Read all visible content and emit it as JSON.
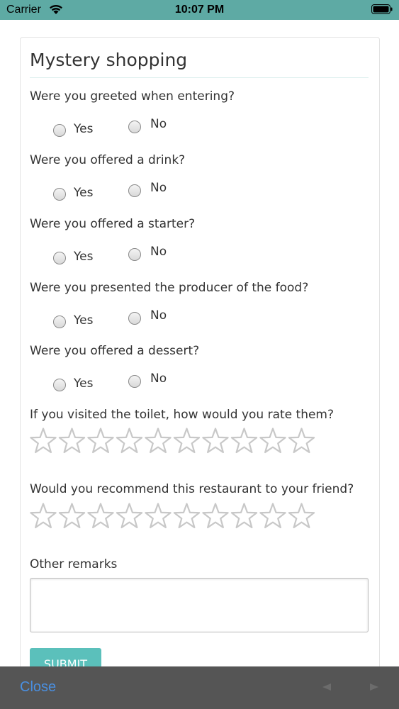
{
  "status_bar": {
    "carrier": "Carrier",
    "time": "10:07 PM"
  },
  "form": {
    "title": "Mystery shopping",
    "questions": [
      {
        "text": "Were you greeted when entering?",
        "yes_label": "Yes",
        "no_label": "No"
      },
      {
        "text": "Were you offered a drink?",
        "yes_label": "Yes",
        "no_label": "No"
      },
      {
        "text": "Were you offered a starter?",
        "yes_label": "Yes",
        "no_label": "No"
      },
      {
        "text": "Were you presented the producer of the food?",
        "yes_label": "Yes",
        "no_label": "No"
      },
      {
        "text": "Were you offered a dessert?",
        "yes_label": "Yes",
        "no_label": "No"
      }
    ],
    "ratings": [
      {
        "text": "If you visited the toilet, how would you rate them?",
        "max_stars": 10,
        "value": 0
      },
      {
        "text": "Would you recommend this restaurant to your friend?",
        "max_stars": 10,
        "value": 0
      }
    ],
    "remarks_label": "Other remarks",
    "remarks_value": "",
    "submit_label": "SUBMIT"
  },
  "toolbar": {
    "close_label": "Close"
  },
  "colors": {
    "status_bar": "#5eaaa4",
    "submit": "#5bc0bb",
    "toolbar": "#555555",
    "close_link": "#4a8fe0",
    "star_outline": "#c8c8c8"
  }
}
